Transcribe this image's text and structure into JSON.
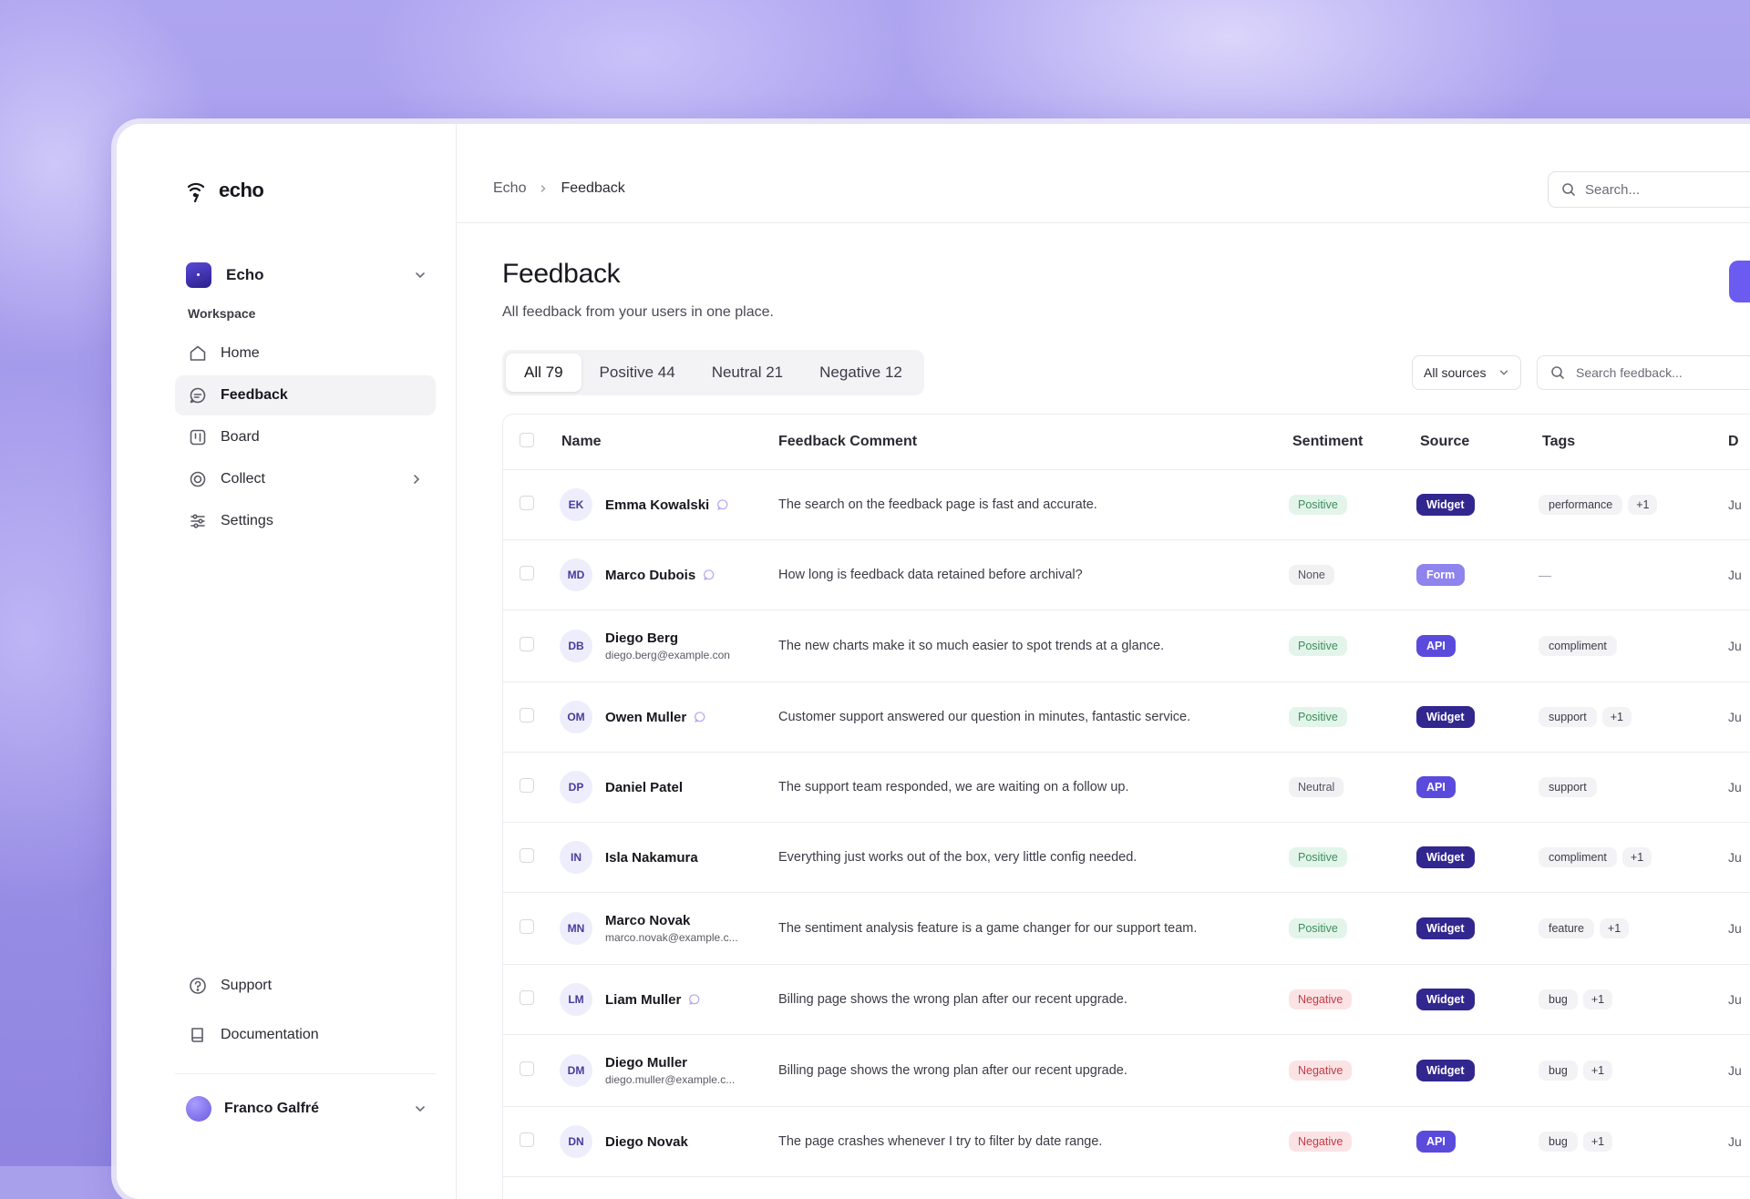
{
  "app": {
    "name": "echo"
  },
  "workspace": {
    "name": "Echo",
    "section_label": "Workspace"
  },
  "nav": {
    "items": [
      {
        "label": "Home",
        "icon": "home-icon"
      },
      {
        "label": "Feedback",
        "icon": "chat-bubble-icon",
        "active": true
      },
      {
        "label": "Board",
        "icon": "board-icon"
      },
      {
        "label": "Collect",
        "icon": "collect-icon"
      },
      {
        "label": "Settings",
        "icon": "sliders-icon"
      }
    ],
    "bottom": [
      {
        "label": "Support",
        "icon": "help-circle-icon"
      },
      {
        "label": "Documentation",
        "icon": "book-icon"
      }
    ]
  },
  "user": {
    "name": "Franco Galfré"
  },
  "breadcrumb": [
    "Echo",
    "Feedback"
  ],
  "top_search": {
    "placeholder": "Search..."
  },
  "page": {
    "title": "Feedback",
    "subtitle": "All feedback from your users in one place."
  },
  "filters": {
    "tabs": [
      {
        "label": "All 79",
        "active": true
      },
      {
        "label": "Positive 44"
      },
      {
        "label": "Neutral 21"
      },
      {
        "label": "Negative 12"
      }
    ],
    "source_select": "All sources",
    "search_placeholder": "Search feedback..."
  },
  "table": {
    "columns": [
      "Name",
      "Feedback Comment",
      "Sentiment",
      "Source",
      "Tags",
      "D"
    ],
    "rows": [
      {
        "initials": "EK",
        "name": "Emma Kowalski",
        "email": "",
        "chat": true,
        "comment": "The search on the feedback page is fast and accurate.",
        "sentiment": "Positive",
        "source": "Widget",
        "tag": "performance",
        "more": "+1",
        "date": "Ju"
      },
      {
        "initials": "MD",
        "name": "Marco Dubois",
        "email": "",
        "chat": true,
        "comment": "How long is feedback data retained before archival?",
        "sentiment": "None",
        "source": "Form",
        "tag": "—",
        "more": "",
        "date": "Ju"
      },
      {
        "initials": "DB",
        "name": "Diego Berg",
        "email": "diego.berg@example.con",
        "chat": false,
        "comment": "The new charts make it so much easier to spot trends at a glance.",
        "sentiment": "Positive",
        "source": "API",
        "tag": "compliment",
        "more": "",
        "date": "Ju"
      },
      {
        "initials": "OM",
        "name": "Owen Muller",
        "email": "",
        "chat": true,
        "comment": "Customer support answered our question in minutes, fantastic service.",
        "sentiment": "Positive",
        "source": "Widget",
        "tag": "support",
        "more": "+1",
        "date": "Ju"
      },
      {
        "initials": "DP",
        "name": "Daniel Patel",
        "email": "",
        "chat": false,
        "comment": "The support team responded, we are waiting on a follow up.",
        "sentiment": "Neutral",
        "source": "API",
        "tag": "support",
        "more": "",
        "date": "Ju"
      },
      {
        "initials": "IN",
        "name": "Isla Nakamura",
        "email": "",
        "chat": false,
        "comment": "Everything just works out of the box, very little config needed.",
        "sentiment": "Positive",
        "source": "Widget",
        "tag": "compliment",
        "more": "+1",
        "date": "Ju"
      },
      {
        "initials": "MN",
        "name": "Marco Novak",
        "email": "marco.novak@example.c...",
        "chat": false,
        "comment": "The sentiment analysis feature is a game changer for our support team.",
        "sentiment": "Positive",
        "source": "Widget",
        "tag": "feature",
        "more": "+1",
        "date": "Ju"
      },
      {
        "initials": "LM",
        "name": "Liam Muller",
        "email": "",
        "chat": true,
        "comment": "Billing page shows the wrong plan after our recent upgrade.",
        "sentiment": "Negative",
        "source": "Widget",
        "tag": "bug",
        "more": "+1",
        "date": "Ju"
      },
      {
        "initials": "DM",
        "name": "Diego Muller",
        "email": "diego.muller@example.c...",
        "chat": false,
        "comment": "Billing page shows the wrong plan after our recent upgrade.",
        "sentiment": "Negative",
        "source": "Widget",
        "tag": "bug",
        "more": "+1",
        "date": "Ju"
      },
      {
        "initials": "DN",
        "name": "Diego Novak",
        "email": "",
        "chat": false,
        "comment": "The page crashes whenever I try to filter by date range.",
        "sentiment": "Negative",
        "source": "API",
        "tag": "bug",
        "more": "+1",
        "date": "Ju"
      }
    ]
  },
  "colors": {
    "accent": "#6b5bf0",
    "widget": "#32268f",
    "form": "#8f83ee",
    "api": "#5b4bdc",
    "positive": "#3f8c5c",
    "negative": "#c23a46"
  }
}
